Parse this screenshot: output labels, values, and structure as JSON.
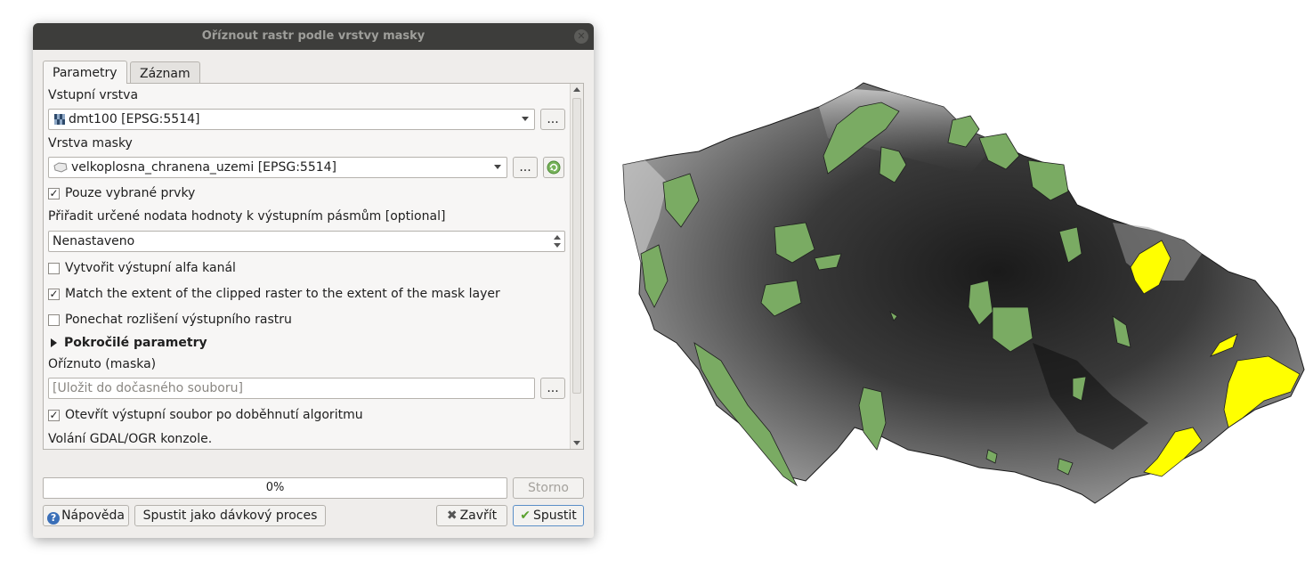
{
  "dialog": {
    "title": "Oříznout rastr podle vrstvy masky",
    "tabs": [
      {
        "label": "Parametry"
      },
      {
        "label": "Záznam"
      }
    ],
    "input_layer_label": "Vstupní vrstva",
    "input_layer_value": "dmt100 [EPSG:5514]",
    "mask_layer_label": "Vrstva masky",
    "mask_layer_value": "velkoplosna_chranena_uzemi [EPSG:5514]",
    "browse_label": "...",
    "selected_only_label": "Pouze vybrané prvky",
    "nodata_label": "Přiřadit určené nodata hodnoty k výstupním pásmům [optional]",
    "nodata_value": "Nenastaveno",
    "alpha_label": "Vytvořit výstupní alfa kanál",
    "match_extent_label": "Match the extent of the clipped raster to the extent of the mask layer",
    "keep_resolution_label": "Ponechat rozlišení výstupního rastru",
    "advanced_label": "Pokročilé parametry",
    "output_label": "Oříznuto (maska)",
    "output_placeholder": "[Uložit do dočasného souboru]",
    "open_output_label": "Otevřít výstupní soubor po doběhnutí algoritmu",
    "console_label": "Volání GDAL/OGR konzole.",
    "checkboxes": {
      "selected_only": true,
      "alpha": false,
      "match_extent": true,
      "keep_resolution": false,
      "open_output": true
    },
    "progress": 0,
    "progress_text": "0%",
    "cancel_label": "Storno",
    "help_label": "Nápověda",
    "batch_label": "Spustit jako dávkový proces",
    "close_label": "Zavřít",
    "run_label": "Spustit"
  },
  "map": {
    "mask_fill": "#7aab63",
    "selected_fill": "#ffff00",
    "dem_low": "#111111",
    "dem_high": "#e6e6e6"
  },
  "icons": [
    "close-icon",
    "raster-layer-icon",
    "vector-layer-icon",
    "iterate-icon",
    "dropdown-arrow-icon",
    "spinbox-arrows-icon",
    "expand-arrow-icon",
    "help-icon",
    "close-x-icon",
    "check-icon"
  ]
}
